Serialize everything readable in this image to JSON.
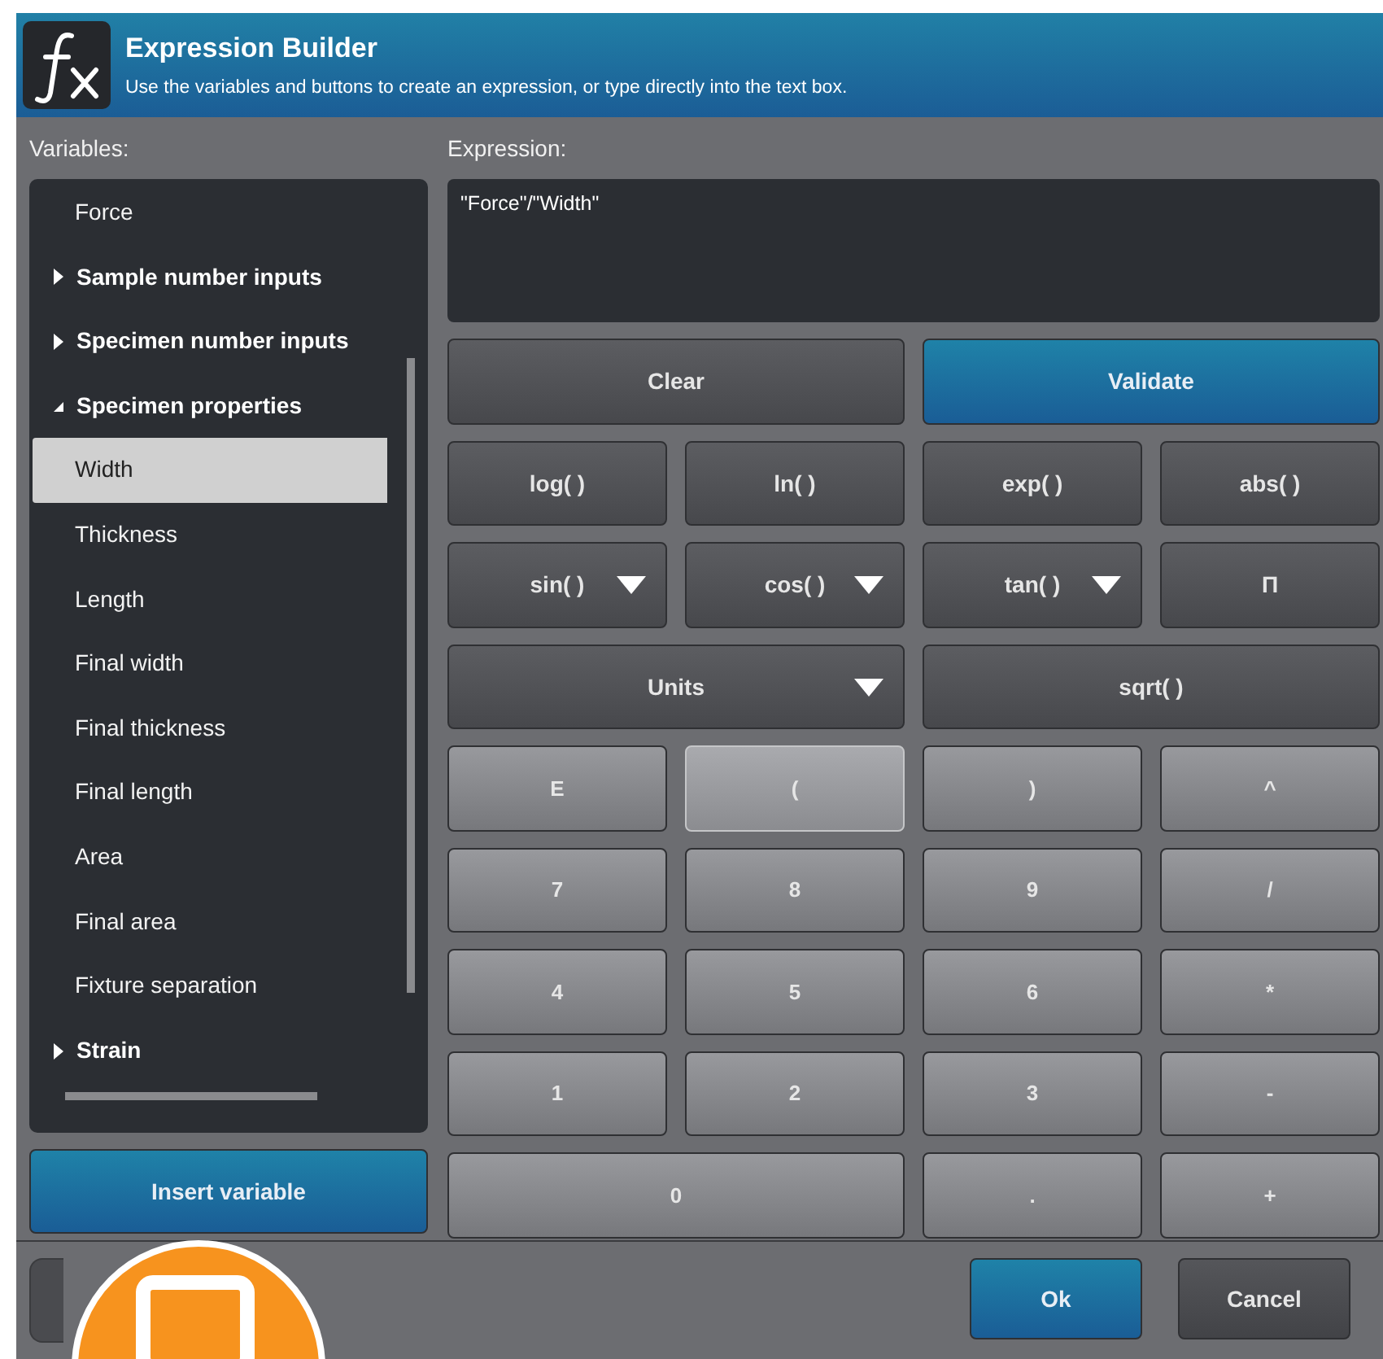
{
  "window": {
    "title": "Expression Builder",
    "subtitle": "Use the variables and buttons to create an expression, or type directly into the text box."
  },
  "variables": {
    "label": "Variables:",
    "items": [
      {
        "label": "Force",
        "selected": false
      },
      {
        "label": "Sample number inputs",
        "expanded": false
      },
      {
        "label": "Specimen number inputs",
        "expanded": false
      },
      {
        "label": "Specimen properties",
        "expanded": true,
        "children": [
          {
            "label": "Width",
            "selected": true
          },
          {
            "label": "Thickness",
            "selected": false
          },
          {
            "label": "Length",
            "selected": false
          },
          {
            "label": "Final width",
            "selected": false
          },
          {
            "label": "Final thickness",
            "selected": false
          },
          {
            "label": "Final length",
            "selected": false
          },
          {
            "label": "Area",
            "selected": false
          },
          {
            "label": "Final area",
            "selected": false
          },
          {
            "label": "Fixture separation",
            "selected": false
          }
        ]
      },
      {
        "label": "Strain",
        "expanded": false
      }
    ]
  },
  "insert_button": "Insert variable",
  "expression": {
    "label": "Expression:",
    "value": "\"Force\"/\"Width\""
  },
  "actions": [
    {
      "label": "Clear",
      "kind": "plain"
    },
    {
      "label": "Validate",
      "kind": "primary"
    }
  ],
  "keypad": [
    [
      {
        "label": "log( )",
        "kind": "function",
        "wide": false,
        "dropdown": false,
        "selected": false
      },
      {
        "label": "ln( )",
        "kind": "function",
        "wide": false,
        "dropdown": false,
        "selected": false
      },
      {
        "label": "exp( )",
        "kind": "function",
        "wide": false,
        "dropdown": false,
        "selected": false
      },
      {
        "label": "abs( )",
        "kind": "function",
        "wide": false,
        "dropdown": false,
        "selected": false
      }
    ],
    [
      {
        "label": "sin( )",
        "kind": "function",
        "wide": false,
        "dropdown": true,
        "selected": false
      },
      {
        "label": "cos( )",
        "kind": "function",
        "wide": false,
        "dropdown": true,
        "selected": false
      },
      {
        "label": "tan( )",
        "kind": "function",
        "wide": false,
        "dropdown": true,
        "selected": false
      },
      {
        "label": "Π",
        "kind": "function",
        "wide": false,
        "dropdown": false,
        "selected": false
      }
    ],
    [
      {
        "label": "Units",
        "kind": "function",
        "wide": true,
        "dropdown": true,
        "selected": false
      },
      {
        "label": "sqrt( )",
        "kind": "function",
        "wide": true,
        "dropdown": false,
        "selected": false
      }
    ],
    [
      {
        "label": "E",
        "kind": "digit",
        "wide": false,
        "dropdown": false,
        "selected": false
      },
      {
        "label": "(",
        "kind": "digit",
        "wide": false,
        "dropdown": false,
        "selected": true
      },
      {
        "label": ")",
        "kind": "digit",
        "wide": false,
        "dropdown": false,
        "selected": false
      },
      {
        "label": "^",
        "kind": "digit",
        "wide": false,
        "dropdown": false,
        "selected": false
      }
    ],
    [
      {
        "label": "7",
        "kind": "digit",
        "wide": false,
        "dropdown": false,
        "selected": false
      },
      {
        "label": "8",
        "kind": "digit",
        "wide": false,
        "dropdown": false,
        "selected": false
      },
      {
        "label": "9",
        "kind": "digit",
        "wide": false,
        "dropdown": false,
        "selected": false
      },
      {
        "label": "/",
        "kind": "digit",
        "wide": false,
        "dropdown": false,
        "selected": false
      }
    ],
    [
      {
        "label": "4",
        "kind": "digit",
        "wide": false,
        "dropdown": false,
        "selected": false
      },
      {
        "label": "5",
        "kind": "digit",
        "wide": false,
        "dropdown": false,
        "selected": false
      },
      {
        "label": "6",
        "kind": "digit",
        "wide": false,
        "dropdown": false,
        "selected": false
      },
      {
        "label": "*",
        "kind": "digit",
        "wide": false,
        "dropdown": false,
        "selected": false
      }
    ],
    [
      {
        "label": "1",
        "kind": "digit",
        "wide": false,
        "dropdown": false,
        "selected": false
      },
      {
        "label": "2",
        "kind": "digit",
        "wide": false,
        "dropdown": false,
        "selected": false
      },
      {
        "label": "3",
        "kind": "digit",
        "wide": false,
        "dropdown": false,
        "selected": false
      },
      {
        "label": "-",
        "kind": "digit",
        "wide": false,
        "dropdown": false,
        "selected": false
      }
    ],
    [
      {
        "label": "0",
        "kind": "digit",
        "wide": true,
        "dropdown": false,
        "selected": false
      },
      {
        "label": ".",
        "kind": "digit",
        "wide": false,
        "dropdown": false,
        "selected": false
      },
      {
        "label": "+",
        "kind": "digit",
        "wide": false,
        "dropdown": false,
        "selected": false
      }
    ]
  ],
  "footer": {
    "buttons": [
      {
        "label": "Ok",
        "kind": "primary"
      },
      {
        "label": "Cancel",
        "kind": "plain"
      }
    ]
  }
}
